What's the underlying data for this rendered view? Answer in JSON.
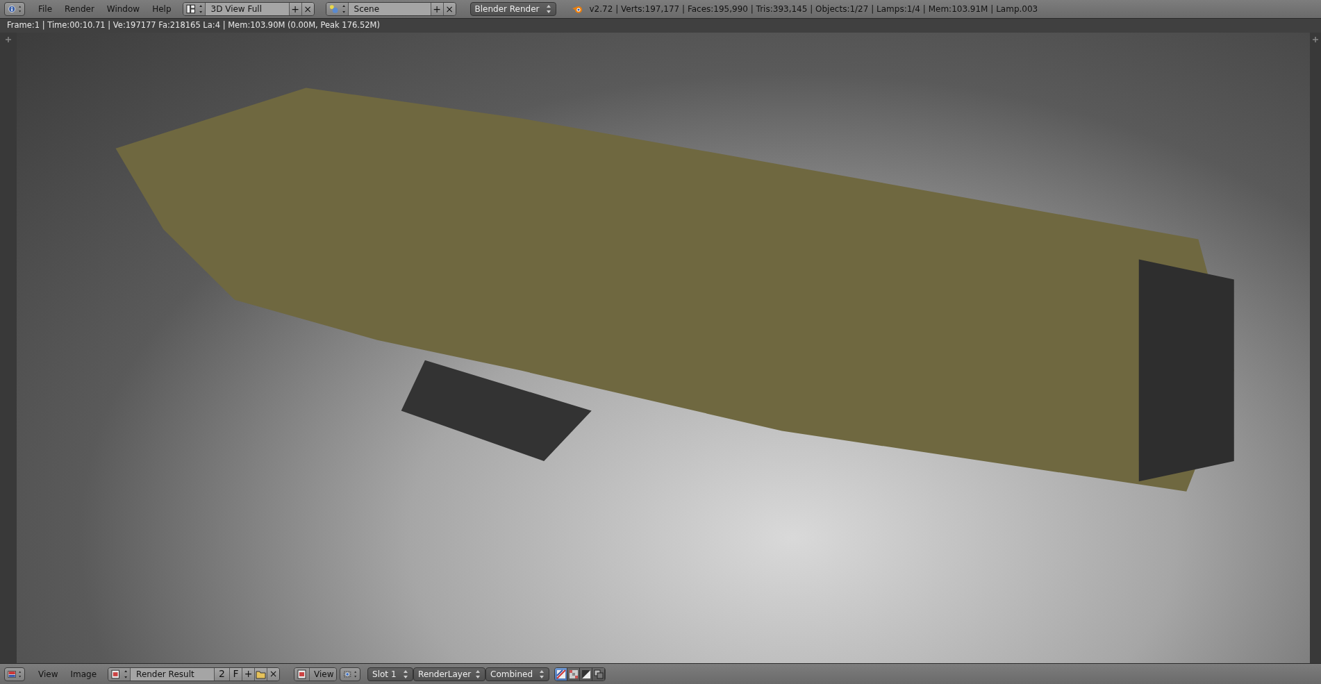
{
  "top_bar": {
    "menu": [
      "File",
      "Render",
      "Window",
      "Help"
    ],
    "screen_layout": {
      "value": "3D View Full",
      "buttons": [
        "+",
        "×"
      ]
    },
    "scene": {
      "value": "Scene",
      "buttons": [
        "+",
        "×"
      ]
    },
    "render_engine": "Blender Render",
    "stats": "v2.72 | Verts:197,177 | Faces:195,990 | Tris:393,145 | Objects:1/27 | Lamps:1/4 | Mem:103.91M | Lamp.003"
  },
  "info_line": "Frame:1 | Time:00:10.71 | Ve:197177 Fa:218165 La:4 | Mem:103.90M (0.00M, Peak 176.52M)",
  "image_editor_header": {
    "menu": [
      "View",
      "Image"
    ],
    "image": {
      "value": "Render Result",
      "users": "2",
      "fake_user": "F",
      "buttons": [
        "+",
        "×"
      ]
    },
    "view": "View",
    "slot": "Slot 1",
    "layer": "RenderLayer",
    "pass": "Combined",
    "display_modes": [
      {
        "kind": "color",
        "selected": true
      },
      {
        "kind": "alpha",
        "selected": false
      },
      {
        "kind": "z",
        "selected": false
      },
      {
        "kind": "overlay",
        "selected": false
      }
    ]
  }
}
